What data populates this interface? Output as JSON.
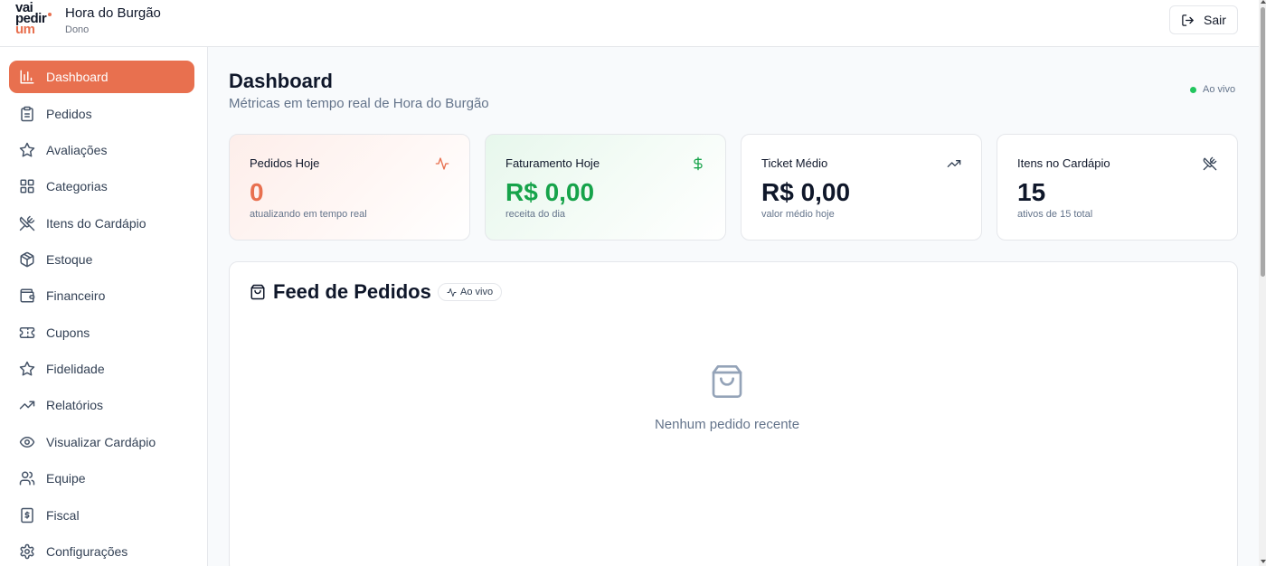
{
  "header": {
    "logo_line1": "vai",
    "logo_line2": "pedir",
    "logo_line3": "um",
    "store_name": "Hora do Burgão",
    "role": "Dono",
    "logout_label": "Sair"
  },
  "sidebar": {
    "items": [
      {
        "label": "Dashboard",
        "icon": "bar-chart-icon",
        "active": true
      },
      {
        "label": "Pedidos",
        "icon": "clipboard-icon"
      },
      {
        "label": "Avaliações",
        "icon": "star-icon"
      },
      {
        "label": "Categorias",
        "icon": "grid-icon"
      },
      {
        "label": "Itens do Cardápio",
        "icon": "utensils-icon"
      },
      {
        "label": "Estoque",
        "icon": "package-icon"
      },
      {
        "label": "Financeiro",
        "icon": "wallet-icon"
      },
      {
        "label": "Cupons",
        "icon": "ticket-icon"
      },
      {
        "label": "Fidelidade",
        "icon": "star-icon"
      },
      {
        "label": "Relatórios",
        "icon": "trending-up-icon"
      },
      {
        "label": "Visualizar Cardápio",
        "icon": "eye-icon"
      },
      {
        "label": "Equipe",
        "icon": "users-icon"
      },
      {
        "label": "Fiscal",
        "icon": "receipt-icon"
      },
      {
        "label": "Configurações",
        "icon": "gear-icon"
      }
    ]
  },
  "main": {
    "title": "Dashboard",
    "subtitle": "Métricas em tempo real de Hora do Burgão",
    "live_label": "Ao vivo",
    "cards": [
      {
        "label": "Pedidos Hoje",
        "value": "0",
        "caption": "atualizando em tempo real",
        "icon": "activity-icon"
      },
      {
        "label": "Faturamento Hoje",
        "value": "R$ 0,00",
        "caption": "receita do dia",
        "icon": "dollar-icon"
      },
      {
        "label": "Ticket Médio",
        "value": "R$ 0,00",
        "caption": "valor médio hoje",
        "icon": "trending-up-icon"
      },
      {
        "label": "Itens no Cardápio",
        "value": "15",
        "caption": "ativos de 15 total",
        "icon": "utensils-icon"
      }
    ],
    "feed": {
      "title": "Feed de Pedidos",
      "badge": "Ao vivo",
      "empty_text": "Nenhum pedido recente"
    }
  },
  "colors": {
    "accent": "#e8704f",
    "success": "#16a34a",
    "live_dot": "#22c55e"
  }
}
